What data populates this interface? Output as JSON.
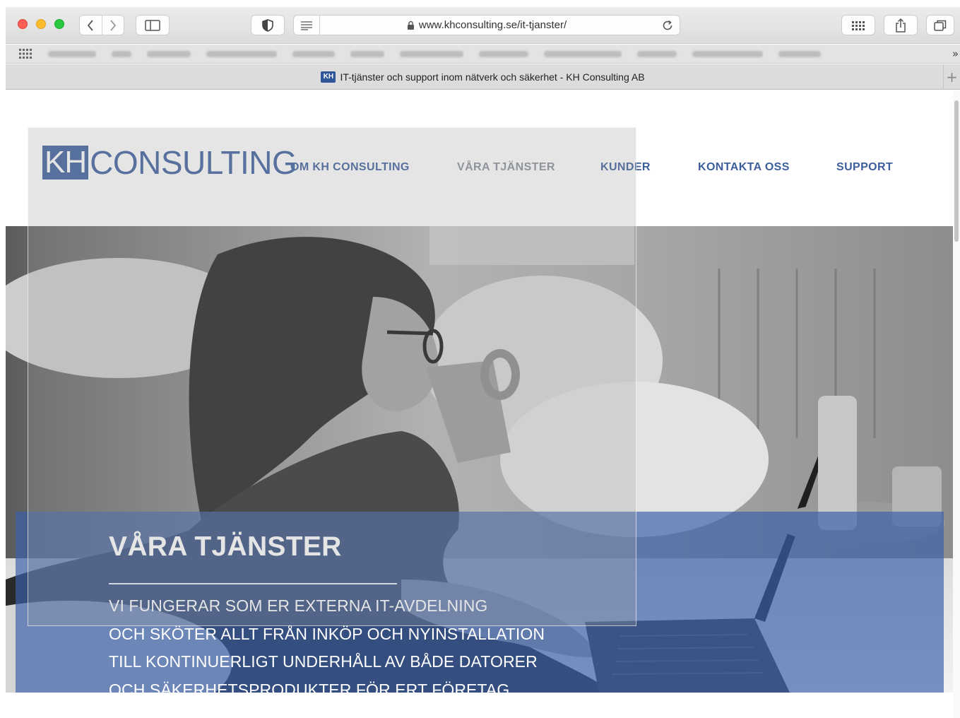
{
  "browser": {
    "url": "www.khconsulting.se/it-tjanster/",
    "tab": {
      "favicon_text": "KH",
      "title": "IT-tjänster och support inom nätverk och säkerhet - KH Consulting AB"
    },
    "bookmarks_overflow": "»",
    "new_tab_label": "+"
  },
  "site": {
    "logo": {
      "kh": "KH",
      "rest": "CONSULTING"
    },
    "nav": [
      {
        "label": "OM KH CONSULTING"
      },
      {
        "label": "VÅRA TJÄNSTER"
      },
      {
        "label": "KUNDER"
      },
      {
        "label": "KONTAKTA OSS"
      },
      {
        "label": "SUPPORT"
      }
    ],
    "hero": {
      "title": "VÅRA TJÄNSTER",
      "lines": [
        "VI FUNGERAR SOM ER EXTERNA IT-AVDELNING",
        "OCH SKÖTER ALLT FRÅN INKÖP OCH NYINSTALLATION",
        "TILL KONTINUERLIGT UNDERHÅLL AV BÅDE DATORER",
        "OCH SÄKERHETSPRODUKTER FÖR ERT FÖRETAG"
      ]
    }
  },
  "colors": {
    "brand_blue": "#3c5e9b",
    "nav_active_gray": "#888f99",
    "banner_overlay": "#3a60a8"
  }
}
